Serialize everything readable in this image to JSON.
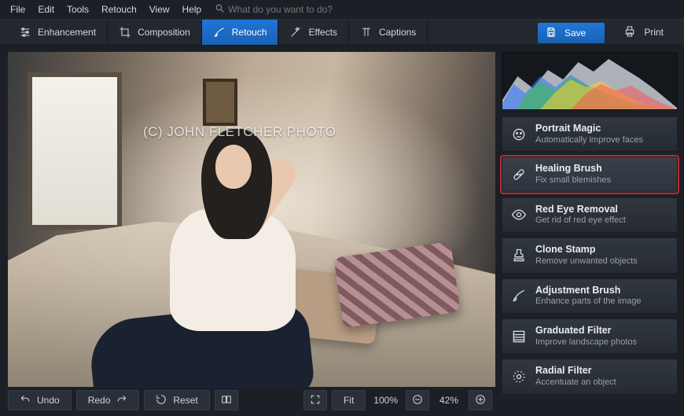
{
  "menubar": {
    "items": [
      "File",
      "Edit",
      "Tools",
      "Retouch",
      "View",
      "Help"
    ],
    "search_placeholder": "What do you want to do?"
  },
  "toolbar": {
    "tabs": [
      {
        "id": "enhancement",
        "label": "Enhancement"
      },
      {
        "id": "composition",
        "label": "Composition"
      },
      {
        "id": "retouch",
        "label": "Retouch"
      },
      {
        "id": "effects",
        "label": "Effects"
      },
      {
        "id": "captions",
        "label": "Captions"
      }
    ],
    "active_tab": "retouch",
    "save_label": "Save",
    "print_label": "Print"
  },
  "canvas": {
    "watermark": "(C) JOHN FLETCHER PHOTO"
  },
  "bottombar": {
    "undo_label": "Undo",
    "redo_label": "Redo",
    "reset_label": "Reset",
    "fit_label": "Fit",
    "zoom_display": "100%",
    "zoom_slider": "42%"
  },
  "right_panel": {
    "tools": [
      {
        "id": "portrait-magic",
        "title": "Portrait Magic",
        "desc": "Automatically improve faces"
      },
      {
        "id": "healing-brush",
        "title": "Healing Brush",
        "desc": "Fix small blemishes"
      },
      {
        "id": "red-eye",
        "title": "Red Eye Removal",
        "desc": "Get rid of red eye effect"
      },
      {
        "id": "clone-stamp",
        "title": "Clone Stamp",
        "desc": "Remove unwanted objects"
      },
      {
        "id": "adjustment-brush",
        "title": "Adjustment Brush",
        "desc": "Enhance parts of the image"
      },
      {
        "id": "graduated-filter",
        "title": "Graduated Filter",
        "desc": "Improve landscape photos"
      },
      {
        "id": "radial-filter",
        "title": "Radial Filter",
        "desc": "Accentuate an object"
      }
    ],
    "selected_tool": "healing-brush"
  }
}
